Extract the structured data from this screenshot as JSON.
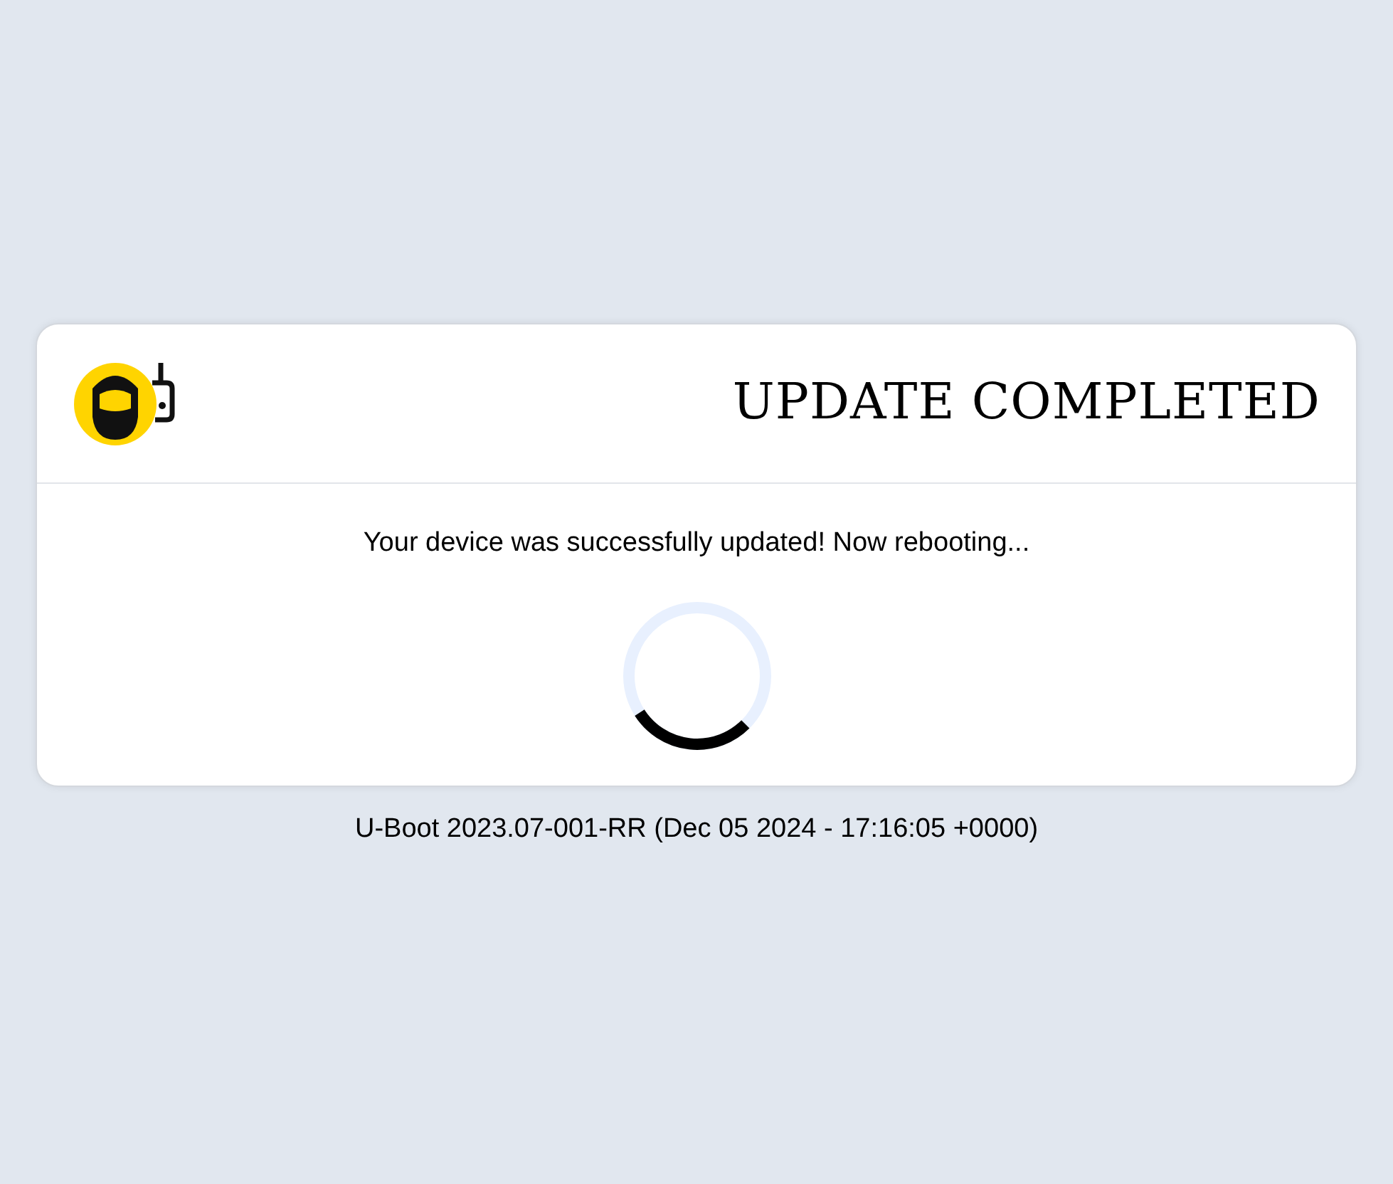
{
  "card": {
    "title": "UPDATE COMPLETED",
    "message": "Your device was successfully updated! Now rebooting..."
  },
  "footer": "U-Boot 2023.07-001-RR (Dec 05 2024 - 17:16:05 +0000)"
}
